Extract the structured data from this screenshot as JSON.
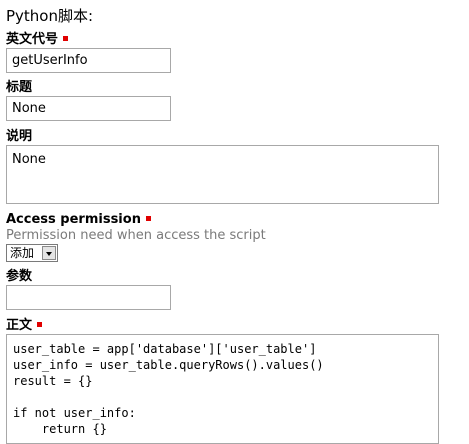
{
  "page_title": "Python脚本:",
  "fields": {
    "code_name": {
      "label": "英文代号",
      "value": "getUserInfo"
    },
    "title": {
      "label": "标题",
      "value": "None"
    },
    "description": {
      "label": "说明",
      "value": "None"
    },
    "access": {
      "label": "Access permission",
      "hint": "Permission need when access the script",
      "selected": "添加"
    },
    "params": {
      "label": "参数",
      "value": ""
    },
    "body": {
      "label": "正文",
      "code": "user_table = app['database']['user_table']\nuser_info = user_table.queryRows().values()\nresult = {}\n\nif not user_info:\n    return {}"
    }
  },
  "colors": {
    "required_marker": "#e00000",
    "border": "#a8a8a8",
    "hint": "#7a7a7a"
  }
}
